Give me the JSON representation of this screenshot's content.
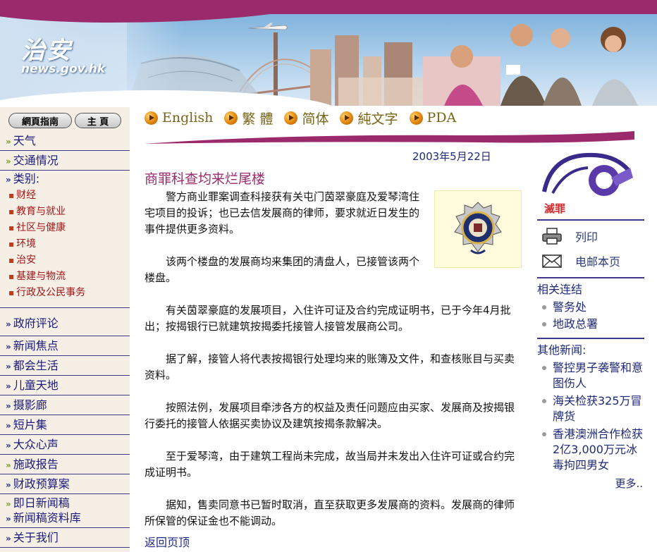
{
  "header": {
    "site_title": "治安",
    "site_url": "news.gov.hk"
  },
  "leftnav": {
    "guide_label": "網頁指南",
    "home_label": "主 頁",
    "top_items": [
      "天气",
      "交通情况"
    ],
    "category_label": "类别:",
    "categories": [
      "财经",
      "教育与就业",
      "社区与健康",
      "环境",
      "治安",
      "基建与物流",
      "行政及公民事务"
    ],
    "gov_comment": "政府评论",
    "bottom_items": [
      "新闻焦点",
      "都会生活",
      "儿童天地",
      "摄影廊",
      "短片集",
      "大众心声",
      "施政报告",
      "财政预算案",
      "即日新闻稿",
      "新闻稿资料库",
      "关于我们"
    ]
  },
  "langbar": {
    "items": [
      "English",
      "繁 體",
      "简体",
      "純文字",
      "PDA"
    ]
  },
  "article": {
    "date": "2003年5月22日",
    "title": "商罪科查均来烂尾楼",
    "paragraphs": [
      "警方商业罪案调查科接获有关屯门茵翠豪庭及爱琴湾住宅项目的投诉；也已去信发展商的律师，要求就近日发生的事件提供更多资料。",
      "该两个楼盘的发展商均来集团的清盘人，已接管该两个楼盘。",
      "有关茵翠豪庭的发展项目，入住许可证及合约完成证明书，已于今年4月批出；按揭银行已就建筑按揭委托接管人接管发展商公司。",
      "据了解，接管人将代表按揭银行处理均来的账簿及文件，和查核账目与买卖资料。",
      "按照法例，发展项目牵涉各方的权益及责任问题应由买家、发展商及按揭银行委托的接管人依据买卖协议及建筑按揭条款解决。",
      "至于爱琴湾，由于建筑工程尚未完成，故当局并未发出入住许可证或合约完成证明书。",
      "据知，售卖同意书已暂时取消，直至获取更多发展商的资料。发展商的律师所保管的保证金也不能调动。"
    ],
    "back_label": "返回页顶"
  },
  "rightcol": {
    "crime_label": "滅罪",
    "print_label": "列印",
    "email_label": "电邮本页",
    "related_head": "相关连结",
    "related": [
      "警务处",
      "地政总署"
    ],
    "other_head": "其他新闻:",
    "other_news": [
      "警控男子袭警和意图伤人",
      "海关检获325万冒牌货",
      "香港澳洲合作检获2亿3,000万元冰毒拘四男女"
    ],
    "more_label": "更多.."
  },
  "colors": {
    "brand_magenta": "#9a2a6c",
    "nav_bg": "#f6efe6",
    "link_blue": "#1e2a7a",
    "sub_red": "#a31616"
  }
}
